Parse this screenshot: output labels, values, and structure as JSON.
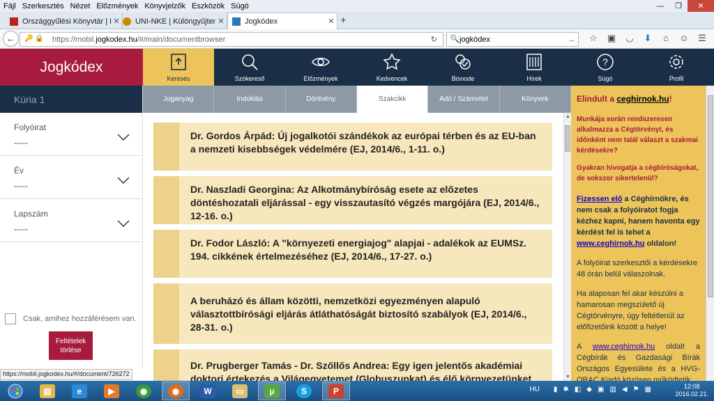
{
  "menubar": {
    "items": [
      "Fájl",
      "Szerkesztés",
      "Nézet",
      "Előzmények",
      "Könyvjelzők",
      "Eszközök",
      "Súgó"
    ]
  },
  "window": {
    "min": "—",
    "max": "❐",
    "close": "✕"
  },
  "tabs": [
    {
      "label": "Országgyűlési Könyvtár | EU",
      "icon_color": "#b22"
    },
    {
      "label": "UNI-NKE | Különgyűjteméne...",
      "icon_color": "#c80"
    },
    {
      "label": "Jogkódex",
      "icon_color": "#2a7ab8"
    }
  ],
  "newtab": "+",
  "address": {
    "prefix": "https://mobil.",
    "domain": "jogkodex.hu",
    "suffix": "/#/main/documentbrowser"
  },
  "search": {
    "value": "jogkódex"
  },
  "site": {
    "logo": "Jogkódex",
    "nav": [
      {
        "label": "Keresés",
        "icon": "search-doc-icon"
      },
      {
        "label": "Szókereső",
        "icon": "magnifier-icon"
      },
      {
        "label": "Előzmények",
        "icon": "eye-icon"
      },
      {
        "label": "Kedvencek",
        "icon": "star-icon"
      },
      {
        "label": "Bisnode",
        "icon": "bisnode-icon"
      },
      {
        "label": "Hírek",
        "icon": "news-icon"
      },
      {
        "label": "Súgó",
        "icon": "help-icon"
      },
      {
        "label": "Profil",
        "icon": "gear-icon"
      }
    ],
    "subtabs": [
      "Joganyag",
      "Indoklás",
      "Döntvény",
      "Szakcikk",
      "Adó / Számvitel",
      "Könyvek"
    ],
    "active_subtab": "Szakcikk"
  },
  "sidebar": {
    "title": "Kúria 1",
    "filters": [
      {
        "label": "Folyóirat",
        "value": "-----"
      },
      {
        "label": "Év",
        "value": "-----"
      },
      {
        "label": "Lapszám",
        "value": "-----"
      }
    ],
    "access_label": "Csak, amihez hozzáférésem van.",
    "clear_button": "Feltételek törlése"
  },
  "articles": [
    "Dr. Gordos Árpád: Új jogalkotói szándékok az európai térben és az EU-ban a nemzeti kisebbségek védelmére (EJ, 2014/6., 1-11. o.)",
    "Dr. Naszladi Georgina: Az Alkotmánybíróság esete az előzetes döntéshozatali eljárással - egy visszautasító végzés margójára (EJ, 2014/6., 12-16. o.)",
    "Dr. Fodor László: A \"környezeti energiajog\" alapjai - adalékok az EUMSz. 194. cikkének értelmezéséhez (EJ, 2014/6., 17-27. o.)",
    "A beruházó és állam közötti, nemzetközi egyezményen alapuló választottbírósági eljárás átláthatóságát biztosító szabályok (EJ, 2014/6., 28-31. o.)",
    "Dr. Prugberger Tamás - Dr. Szőllős Andrea: Egy igen jelentős akadémiai doktori értekezés a Világegyetemet (Globuszunkat) és élő környezetünket"
  ],
  "ad": {
    "headline_pre": "Elindult a ",
    "headline_link": "ceghirnok.hu",
    "headline_post": "!",
    "q1": "Munkája során rendszeresen alkalmazza a Cégtörvényt, és időnként nem talál választ a szakmai kérdésekre?",
    "q2": "Gyakran hívogatja a cégbíróságokat, de sokszor sikertelenül?",
    "offer_link": "Fizessen elő",
    "offer_text": " a Céghírnökre, és nem csak a folyóiratot fogja kézhez kapni, hanem havonta egy kérdést fel is tehet a ",
    "offer_link2": "www.ceghirnok.hu",
    "offer_tail": " oldalon!",
    "p1": "A folyóirat szerkesztői a kérdésekre 48 órán belül válaszolnak.",
    "p2": "Ha alaposan fel akar készülni a hamarosan megszülető új Cégtörvényre, úgy feltétlenül az előfizetőink között a helye!",
    "p3_pre": "A ",
    "p3_link": "www.ceghirnok.hu",
    "p3_post": " oldalt a Cégbírák és Gazdasági Bírák Országos Egyesülete és a HVG-ORAC Kiadó közösen működtetik."
  },
  "status_url": "https://mobil.jogkodex.hu/#/document/726272",
  "taskbar": {
    "apps": [
      {
        "name": "explorer",
        "color": "#e8b84a",
        "glyph": "▤"
      },
      {
        "name": "ie",
        "color": "#2a8ad8",
        "glyph": "e"
      },
      {
        "name": "media",
        "color": "#e07a2a",
        "glyph": "▶"
      },
      {
        "name": "chrome",
        "color": "#3a9a3a",
        "glyph": "◉"
      },
      {
        "name": "firefox",
        "color": "#e06a1a",
        "glyph": "◉"
      },
      {
        "name": "word",
        "color": "#2a5aa8",
        "glyph": "W"
      },
      {
        "name": "folder",
        "color": "#d8c070",
        "glyph": "▭"
      },
      {
        "name": "utorrent",
        "color": "#5aa83a",
        "glyph": "µ"
      },
      {
        "name": "skype",
        "color": "#1aa0e0",
        "glyph": "S"
      },
      {
        "name": "powerpoint",
        "color": "#c8442a",
        "glyph": "P"
      }
    ],
    "lang": "HU",
    "time": "12:08",
    "date": "2016.02.21."
  }
}
